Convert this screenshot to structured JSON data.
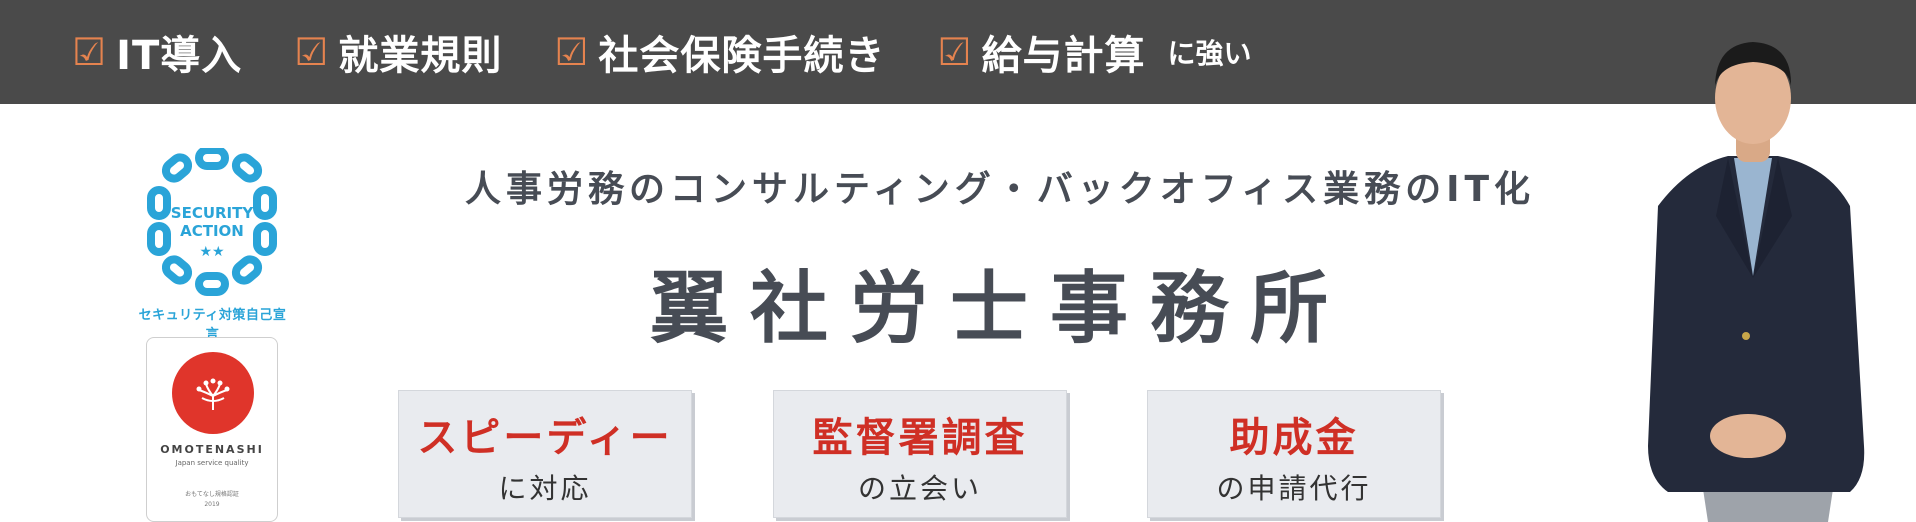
{
  "header": {
    "items": [
      {
        "check": "☑",
        "label": "IT導入"
      },
      {
        "check": "☑",
        "label": "就業規則"
      },
      {
        "check": "☑",
        "label": "社会保険手続き"
      },
      {
        "check": "☑",
        "label": "給与計算"
      }
    ],
    "suffix": "に強い"
  },
  "badges": {
    "security": {
      "title_line1": "SECURITY",
      "title_line2": "ACTION",
      "stars": "★★",
      "caption": "セキュリティ対策自己宣言"
    },
    "omotenashi": {
      "brand": "OMOTENASHI",
      "subtitle": "Japan service quality",
      "note": "おもてなし規格認証",
      "year": "2019"
    }
  },
  "hero": {
    "tagline": "人事労務のコンサルティング・バックオフィス業務のIT化",
    "office_name": "翼社労士事務所"
  },
  "services": [
    {
      "main": "スピーディー",
      "sub": "に対応"
    },
    {
      "main": "監督署調査",
      "sub": "の立会い"
    },
    {
      "main": "助成金",
      "sub": "の申請代行"
    }
  ],
  "colors": {
    "topbar": "#4a4a4a",
    "check_accent": "#e5834f",
    "security_blue": "#2aa4d8",
    "service_red": "#cf2f25",
    "omotenashi_red": "#e0352b",
    "text_dark": "#474c55"
  }
}
